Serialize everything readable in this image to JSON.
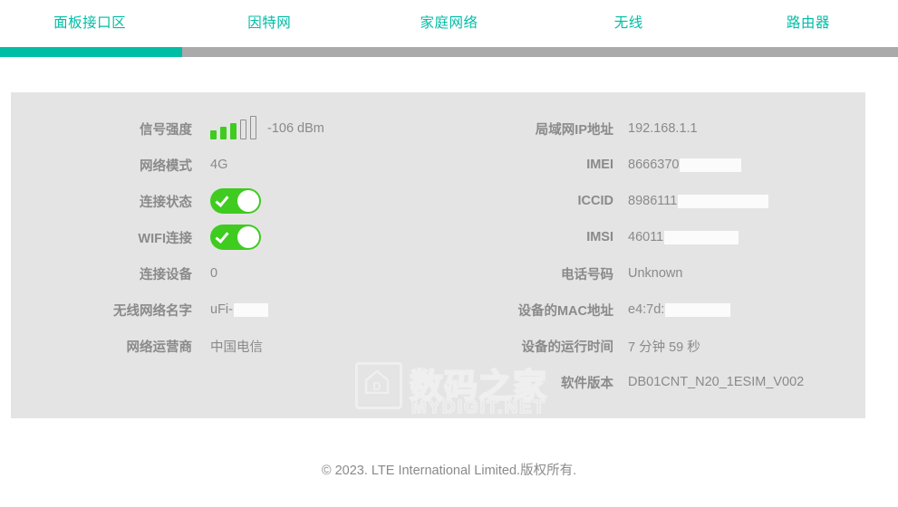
{
  "nav": {
    "tabs": [
      {
        "label": "面板接口区",
        "active": true
      },
      {
        "label": "因特网",
        "active": false
      },
      {
        "label": "家庭网络",
        "active": false
      },
      {
        "label": "无线",
        "active": false
      },
      {
        "label": "路由器",
        "active": false
      }
    ],
    "accent_color": "#00bda5",
    "rail_color": "#aaaaaa"
  },
  "panel": {
    "background": "#e4e4e4",
    "left": {
      "signal_strength": {
        "label": "信号强度",
        "value": "-106 dBm",
        "bars_total": 5,
        "bars_filled": 3,
        "bar_on_color": "#3fcb20",
        "bar_off_color": "#909090"
      },
      "network_mode": {
        "label": "网络模式",
        "value": "4G"
      },
      "connection_status": {
        "label": "连接状态",
        "value": "on",
        "toggle_color": "#3fcb20"
      },
      "wifi_connection": {
        "label": "WIFI连接",
        "value": "on",
        "toggle_color": "#3fcb20"
      },
      "connected_devices": {
        "label": "连接设备",
        "value": "0"
      },
      "wifi_name": {
        "label": "无线网络名字",
        "value": "uFi-",
        "redacted_width": 38
      },
      "network_operator": {
        "label": "网络运营商",
        "value": "中国电信"
      }
    },
    "right": {
      "lan_ip": {
        "label": "局域网IP地址",
        "value": "192.168.1.1"
      },
      "imei": {
        "label": "IMEI",
        "value": "8666370",
        "redacted_width": 68
      },
      "iccid": {
        "label": "ICCID",
        "value": "8986111",
        "redacted_width": 100
      },
      "imsi": {
        "label": "IMSI",
        "value": "46011",
        "redacted_width": 82
      },
      "phone_number": {
        "label": "电话号码",
        "value": "Unknown"
      },
      "mac_address": {
        "label": "设备的MAC地址",
        "value": "e4:7d:",
        "redacted_width": 72
      },
      "uptime": {
        "label": "设备的运行时间",
        "value": "7 分钟 59 秒"
      },
      "software_version": {
        "label": "软件版本",
        "value": "DB01CNT_N20_1ESIM_V002"
      }
    }
  },
  "watermark": {
    "chinese": "数码之家",
    "english": "MYDIGIT.NET",
    "logo_letter": "D"
  },
  "footer": {
    "text": "© 2023. LTE International Limited.版权所有."
  }
}
